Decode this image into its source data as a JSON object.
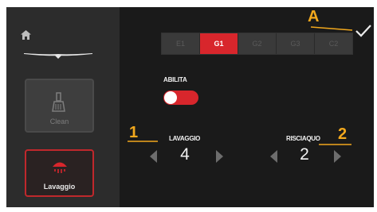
{
  "sidebar": {
    "home_icon": "home-icon",
    "clean": {
      "label": "Clean",
      "icon": "brush-icon"
    },
    "lavaggio": {
      "label": "Lavaggio",
      "icon": "wash-icon"
    }
  },
  "tabs": [
    {
      "label": "E1",
      "active": false
    },
    {
      "label": "G1",
      "active": true
    },
    {
      "label": "G2",
      "active": false
    },
    {
      "label": "G3",
      "active": false
    },
    {
      "label": "C2",
      "active": false
    }
  ],
  "enable": {
    "label": "ABILITA",
    "state": "on"
  },
  "wash": {
    "label": "LAVAGGIO",
    "value": "4"
  },
  "rinse": {
    "label": "RISCIAQUO",
    "value": "2"
  },
  "annotations": {
    "a": "A",
    "one": "1",
    "two": "2"
  },
  "colors": {
    "accent": "#d8262c",
    "annotation": "#f2a81d"
  }
}
